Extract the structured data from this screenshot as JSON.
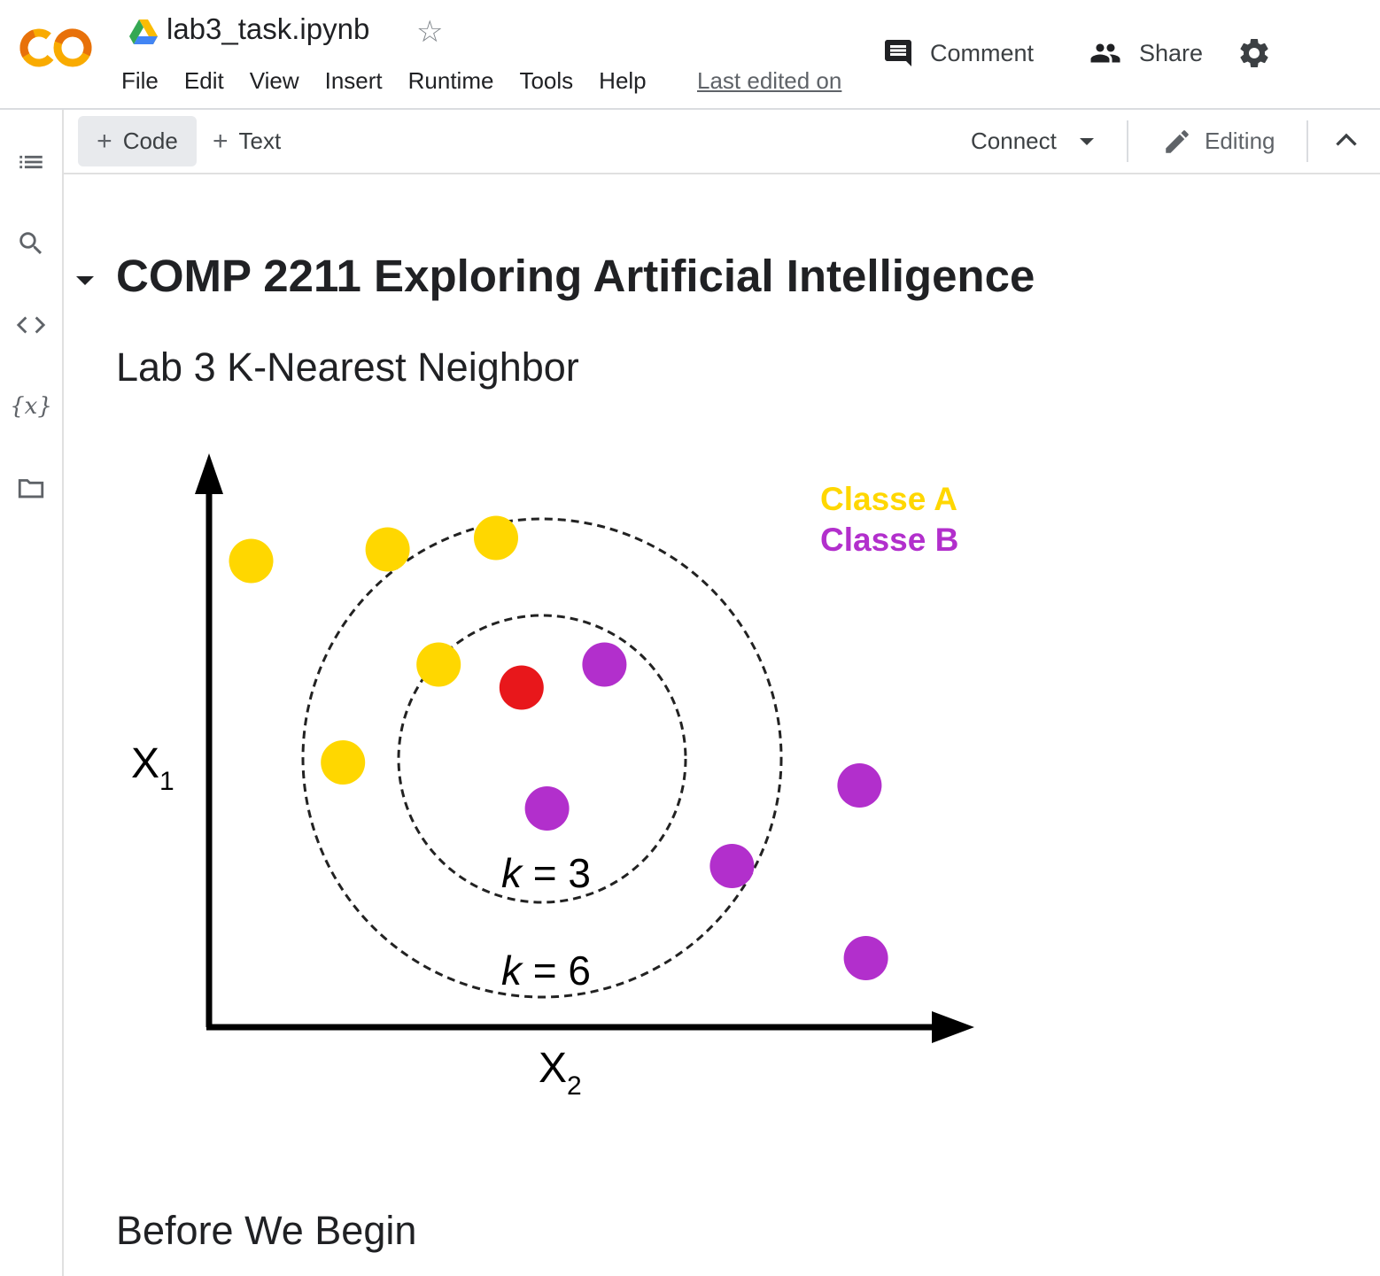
{
  "header": {
    "doc_title": "lab3_task.ipynb",
    "menu": [
      "File",
      "Edit",
      "View",
      "Insert",
      "Runtime",
      "Tools",
      "Help"
    ],
    "last_edited": "Last edited on",
    "comment_label": "Comment",
    "share_label": "Share"
  },
  "toolbar": {
    "add_code_label": "Code",
    "add_text_label": "Text",
    "connect_label": "Connect",
    "editing_label": "Editing"
  },
  "sidebar": {
    "icons": [
      "table-of-contents-icon",
      "search-icon",
      "code-snippets-icon",
      "variables-icon",
      "files-icon"
    ]
  },
  "notebook": {
    "title": "COMP 2211 Exploring Artificial Intelligence",
    "subtitle": "Lab 3 K-Nearest Neighbor",
    "section_heading": "Before We Begin"
  },
  "chart_data": {
    "type": "scatter",
    "xlabel": "X2",
    "ylabel": "X1",
    "legend": [
      {
        "name": "Classe A",
        "color": "#ffd700"
      },
      {
        "name": "Classe B",
        "color": "#b22fcc"
      }
    ],
    "legend_position": "top-right",
    "query_point_color": "#e8171b",
    "annotations": [
      "k = 3",
      "k = 6"
    ],
    "series": [
      {
        "name": "Classe A",
        "color": "#ffd700",
        "points": [
          [
            0.66,
            8.1
          ],
          [
            2.8,
            8.3
          ],
          [
            4.5,
            8.5
          ],
          [
            2.1,
            4.6
          ],
          [
            3.6,
            6.3
          ]
        ]
      },
      {
        "name": "Classe B",
        "color": "#b22fcc",
        "points": [
          [
            6.2,
            6.3
          ],
          [
            5.3,
            3.8
          ],
          [
            8.2,
            2.8
          ],
          [
            10.2,
            4.2
          ],
          [
            10.3,
            1.2
          ]
        ]
      },
      {
        "name": "query",
        "color": "#e8171b",
        "points": [
          [
            4.9,
            5.9
          ]
        ]
      }
    ]
  }
}
